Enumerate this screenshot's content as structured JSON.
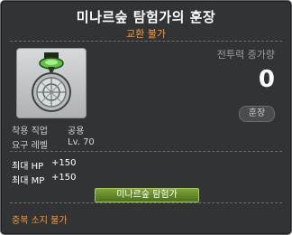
{
  "tooltip": {
    "title": "미나르숲 탐험가의 훈장",
    "subtitle": "교환 불가",
    "power_label": "전투력 증가량",
    "power_value": "0",
    "type_badge": "훈장",
    "icon": "medal-icon",
    "requirements": [
      {
        "label": "착용 직업",
        "value": "공용"
      },
      {
        "label": "요구 레벨",
        "value": "Lv. 70"
      }
    ],
    "stats": [
      {
        "label": "최대 HP",
        "value": "+150"
      },
      {
        "label": "최대 MP",
        "value": "+150"
      }
    ],
    "set_button": "미나르숲 탐험가",
    "footer": "중복 소지 불가"
  },
  "colors": {
    "background": "#313335",
    "accent_orange": "#ff9a2e",
    "button_green": "#5f8a26"
  }
}
